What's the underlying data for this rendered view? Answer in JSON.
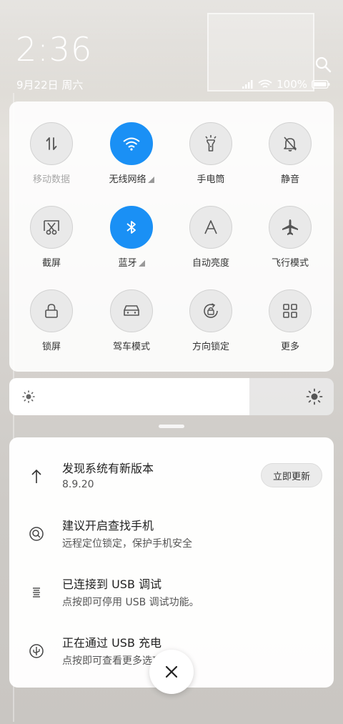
{
  "status": {
    "time": "2:36",
    "date": "9月22日 周六",
    "battery": "100%"
  },
  "tiles": [
    {
      "label": "移动数据",
      "icon": "mobile-data-icon",
      "active": false,
      "dim": true,
      "more": false
    },
    {
      "label": "无线网络",
      "icon": "wifi-icon",
      "active": true,
      "dim": false,
      "more": true
    },
    {
      "label": "手电筒",
      "icon": "flashlight-icon",
      "active": false,
      "dim": false,
      "more": false
    },
    {
      "label": "静音",
      "icon": "mute-bell-icon",
      "active": false,
      "dim": false,
      "more": false
    },
    {
      "label": "截屏",
      "icon": "screenshot-icon",
      "active": false,
      "dim": false,
      "more": false
    },
    {
      "label": "蓝牙",
      "icon": "bluetooth-icon",
      "active": true,
      "dim": false,
      "more": true
    },
    {
      "label": "自动亮度",
      "icon": "auto-brightness-icon",
      "active": false,
      "dim": false,
      "more": false
    },
    {
      "label": "飞行模式",
      "icon": "airplane-icon",
      "active": false,
      "dim": false,
      "more": false
    },
    {
      "label": "锁屏",
      "icon": "lock-icon",
      "active": false,
      "dim": false,
      "more": false
    },
    {
      "label": "驾车模式",
      "icon": "car-icon",
      "active": false,
      "dim": false,
      "more": false
    },
    {
      "label": "方向锁定",
      "icon": "rotation-lock-icon",
      "active": false,
      "dim": false,
      "more": false
    },
    {
      "label": "更多",
      "icon": "grid-more-icon",
      "active": false,
      "dim": false,
      "more": false
    }
  ],
  "brightness": {
    "level": 0.74
  },
  "notifications": [
    {
      "title": "发现系统有新版本",
      "subtitle": "8.9.20",
      "icon": "arrow-up-icon",
      "action": "立即更新"
    },
    {
      "title": "建议开启查找手机",
      "subtitle": "远程定位锁定，保护手机安全",
      "icon": "find-phone-icon"
    },
    {
      "title": "已连接到 USB 调试",
      "subtitle": "点按即可停用 USB 调试功能。",
      "icon": "usb-debug-icon"
    },
    {
      "title": "正在通过 USB 充电",
      "subtitle": "点按即可查看更多选项。",
      "icon": "usb-icon"
    }
  ],
  "colors": {
    "accent": "#1a90f5"
  }
}
